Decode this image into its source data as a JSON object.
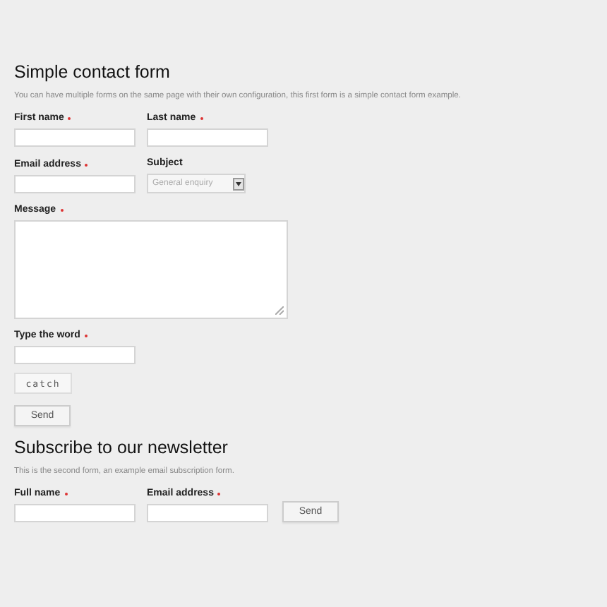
{
  "forms": [
    {
      "title": "Simple contact form",
      "description": "You can have multiple forms on the same page with their own configuration, this first form is a simple contact form example.",
      "rows": [
        [
          {
            "kind": "text",
            "label": "First name",
            "required": true
          },
          {
            "kind": "text",
            "label": "Last name",
            "required": true
          }
        ],
        [
          {
            "kind": "text",
            "label": "Email address",
            "required": true
          },
          {
            "kind": "select",
            "label": "Subject",
            "required": false,
            "value": "General enquiry"
          }
        ],
        [
          {
            "kind": "textarea",
            "label": "Message",
            "required": true
          }
        ],
        [
          {
            "kind": "captcha",
            "label": "Type the word",
            "required": true,
            "word": "catch"
          }
        ],
        [
          {
            "kind": "button",
            "label": "Send"
          }
        ]
      ]
    },
    {
      "title": "Subscribe to our newsletter",
      "description": "This is the second form, an example email subscription form.",
      "rows": [
        [
          {
            "kind": "text",
            "label": "Full name",
            "required": true
          },
          {
            "kind": "text",
            "label": "Email address",
            "required": true
          },
          {
            "kind": "button",
            "label": "Send"
          }
        ]
      ]
    }
  ]
}
